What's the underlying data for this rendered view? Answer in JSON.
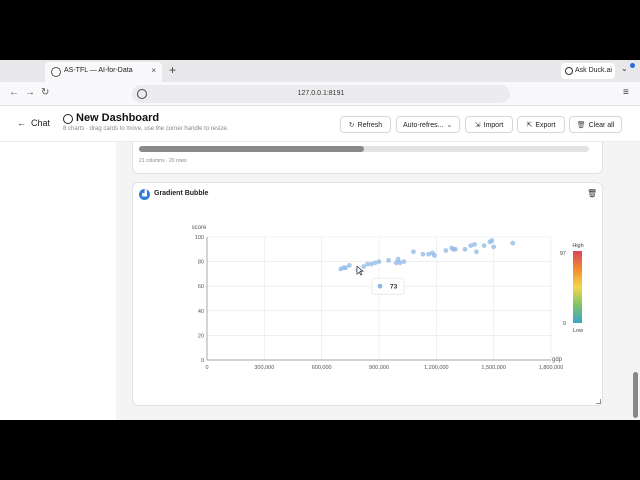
{
  "browser": {
    "tab_title": "AS-TFL — AI-for-Data",
    "tab_close": "×",
    "new_tab": "+",
    "ask_duck": "Ask Duck.ai",
    "url": "127.0.0.1:8191",
    "back": "←",
    "forward": "→",
    "reload": "↻",
    "menu": "≡",
    "expand": "⌄"
  },
  "header": {
    "back_label": "Chat",
    "title": "New Dashboard",
    "subtitle": "8 charts · drag cards to move, use the corner handle to resize.",
    "buttons": {
      "refresh": "Refresh",
      "auto_refresh": "Auto-refres...",
      "import": "Import",
      "export": "Export",
      "clear_all": "Clear all"
    }
  },
  "previous_card": {
    "meta": "21 columns · 20 rows"
  },
  "chart_card": {
    "title": "Gradient Bubble",
    "tooltip_value": "73"
  },
  "chart_data": {
    "type": "scatter",
    "title": "Gradient Bubble",
    "xlabel": "gdp",
    "ylabel": "score",
    "xlim": [
      0,
      1800000
    ],
    "ylim": [
      0,
      100
    ],
    "x_ticks": [
      "0",
      "300,000",
      "600,000",
      "900,000",
      "1,200,000",
      "1,500,000",
      "1,800,000"
    ],
    "y_ticks": [
      "0",
      "20",
      "40",
      "60",
      "80",
      "100"
    ],
    "grid": true,
    "color_scale": {
      "high_label": "High",
      "low_label": "Low",
      "max": "97",
      "min": "0",
      "colors": [
        "#d6475d",
        "#f28b30",
        "#f5d64a",
        "#7dc46a",
        "#3aa7c4"
      ]
    },
    "point_color": "#8db8e6",
    "points": [
      [
        700000,
        74
      ],
      [
        715000,
        75
      ],
      [
        725000,
        75
      ],
      [
        745000,
        77
      ],
      [
        790000,
        73
      ],
      [
        820000,
        76
      ],
      [
        840000,
        78
      ],
      [
        860000,
        78
      ],
      [
        880000,
        79
      ],
      [
        900000,
        80
      ],
      [
        950000,
        81
      ],
      [
        990000,
        79
      ],
      [
        1000000,
        82
      ],
      [
        1010000,
        79
      ],
      [
        1030000,
        80
      ],
      [
        1080000,
        88
      ],
      [
        1130000,
        86
      ],
      [
        1160000,
        86
      ],
      [
        1180000,
        87
      ],
      [
        1190000,
        85
      ],
      [
        1250000,
        89
      ],
      [
        1280000,
        91
      ],
      [
        1290000,
        90
      ],
      [
        1300000,
        90
      ],
      [
        1350000,
        90
      ],
      [
        1380000,
        93
      ],
      [
        1400000,
        94
      ],
      [
        1410000,
        88
      ],
      [
        1450000,
        93
      ],
      [
        1480000,
        96
      ],
      [
        1500000,
        92
      ],
      [
        1490000,
        97
      ],
      [
        1600000,
        95
      ]
    ],
    "highlight": [
      790000,
      73
    ]
  }
}
